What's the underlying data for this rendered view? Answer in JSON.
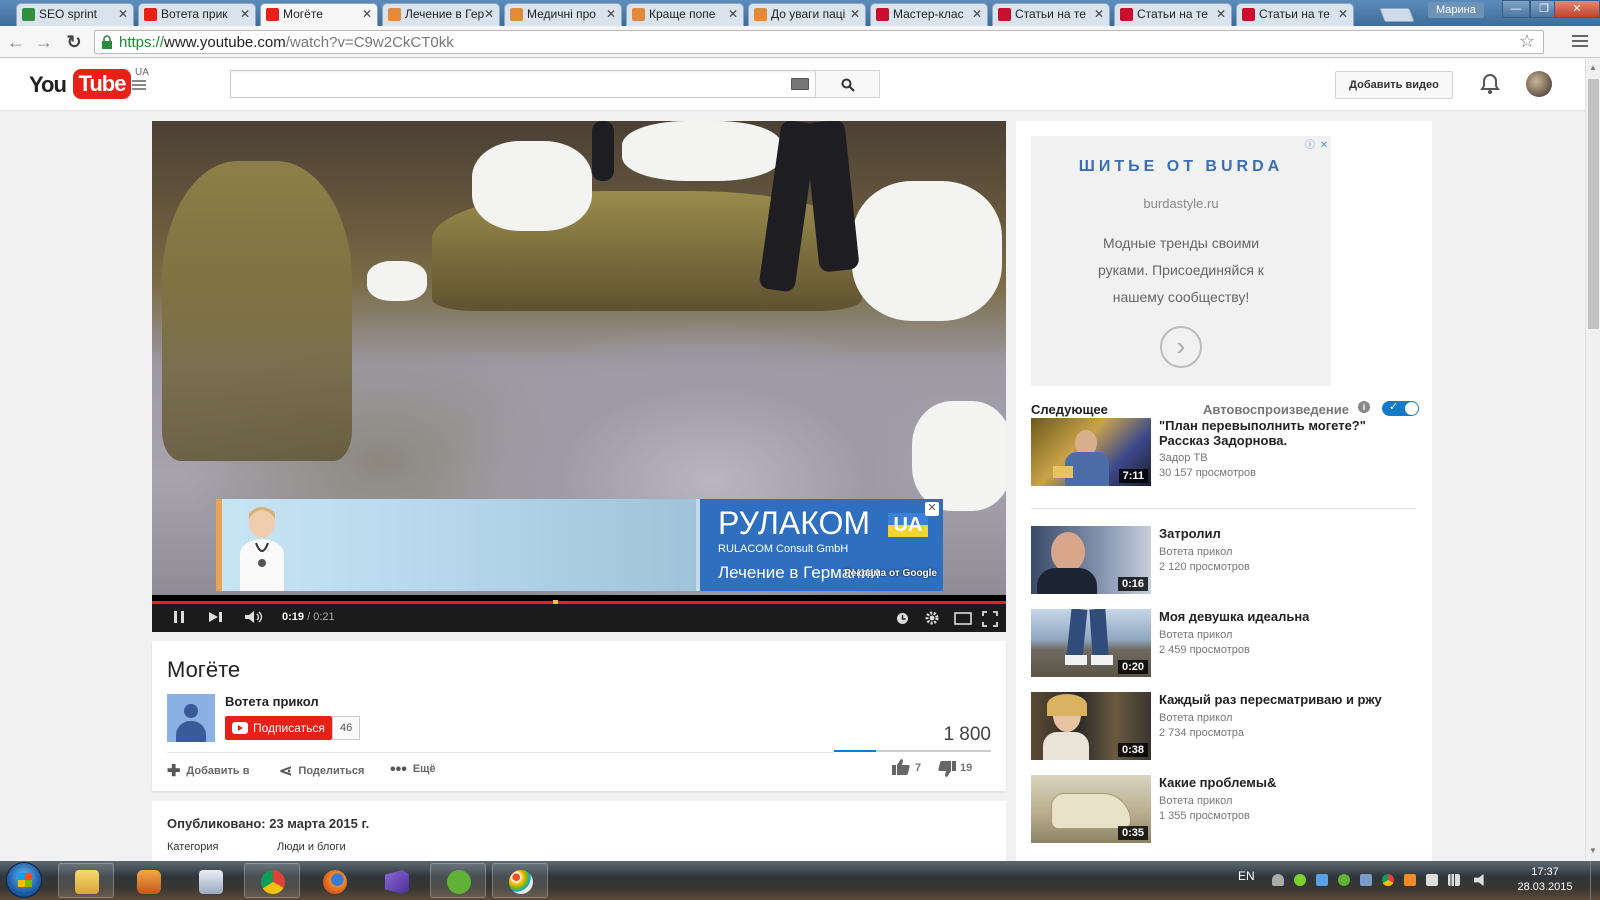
{
  "browser": {
    "tabs": [
      {
        "label": "SEO sprint",
        "color": "#2f8f3e"
      },
      {
        "label": "Вотета прик",
        "color": "#e62117"
      },
      {
        "label": "Могёте",
        "color": "#e62117"
      },
      {
        "label": "Лечение в Гер",
        "color": "#e08a3c"
      },
      {
        "label": "Медичні про",
        "color": "#e08a3c"
      },
      {
        "label": "Краще попе",
        "color": "#e08a3c"
      },
      {
        "label": "До уваги паці",
        "color": "#e08a3c"
      },
      {
        "label": "Мастер-клас",
        "color": "#c8102e"
      },
      {
        "label": "Статьи на те",
        "color": "#c8102e"
      },
      {
        "label": "Статьи на те",
        "color": "#c8102e"
      },
      {
        "label": "Статьи на те",
        "color": "#c8102e"
      }
    ],
    "active_tab": 2,
    "username": "Марина",
    "url_scheme": "https://",
    "url_host": "www.youtube.com",
    "url_path": "/watch?v=C9w2CkCT0kk",
    "window_minimize": "—",
    "window_maximize": "❐",
    "window_close": "✕",
    "nav_back": "←",
    "nav_forward": "→",
    "nav_reload": "↻",
    "bookmark_star": "☆"
  },
  "youtube": {
    "logo_you": "You",
    "logo_tube": "Tube",
    "logo_region": "UA",
    "upload_label": "Добавить видео"
  },
  "player": {
    "time_current": "0:19",
    "time_total": "/ 0:21",
    "progress_fraction": 0.47,
    "overlay_ad": {
      "brand": "РУЛАКОМ",
      "brand_suffix": "UA",
      "company": "RULACOM Consult GmbH",
      "headline": "Лечение в Германии",
      "attribution": "Реклама от Google",
      "close": "✕"
    }
  },
  "video": {
    "title": "Могёте",
    "channel": "Вотета прикол",
    "subscribe_label": "Подписаться",
    "subscriber_count": "46",
    "views": "1 800",
    "actions": [
      "Добавить в",
      "Поделиться",
      "Ещё"
    ],
    "likes": "7",
    "dislikes": "19",
    "like_fraction": 0.27
  },
  "description": {
    "published": "Опубликовано: 23 марта 2015 г.",
    "category_label": "Категория",
    "category_value": "Люди и блоги"
  },
  "sidebar": {
    "ad": {
      "title": "ШИТЬЕ ОТ BURDA",
      "domain": "burdastyle.ru",
      "text": "Модные тренды своими руками. Присоединяйся к нашему сообществу!",
      "arrow": "›",
      "info_icon": "ⓘ",
      "close_icon": "✕"
    },
    "next_label": "Следующее",
    "autoplay_label": "Автовоспроизведение",
    "autoplay_on": true,
    "videos": [
      {
        "title": "\"План перевыполнить могете?\" Рассказ Задорнова.",
        "channel": "Задор ТВ",
        "views": "30 157 просмотров",
        "duration": "7:11"
      },
      {
        "title": "Затролил",
        "channel": "Вотета прикол",
        "views": "2 120 просмотров",
        "duration": "0:16"
      },
      {
        "title": "Моя девушка идеальна",
        "channel": "Вотета прикол",
        "views": "2 459 просмотров",
        "duration": "0:20"
      },
      {
        "title": "Каждый раз пересматриваю и ржу",
        "channel": "Вотета прикол",
        "views": "2 734 просмотра",
        "duration": "0:38"
      },
      {
        "title": "Какие проблемы&",
        "channel": "Вотета прикол",
        "views": "1 355 просмотров",
        "duration": "0:35"
      }
    ]
  },
  "taskbar": {
    "language": "EN",
    "time": "17:37",
    "date": "28.03.2015"
  }
}
